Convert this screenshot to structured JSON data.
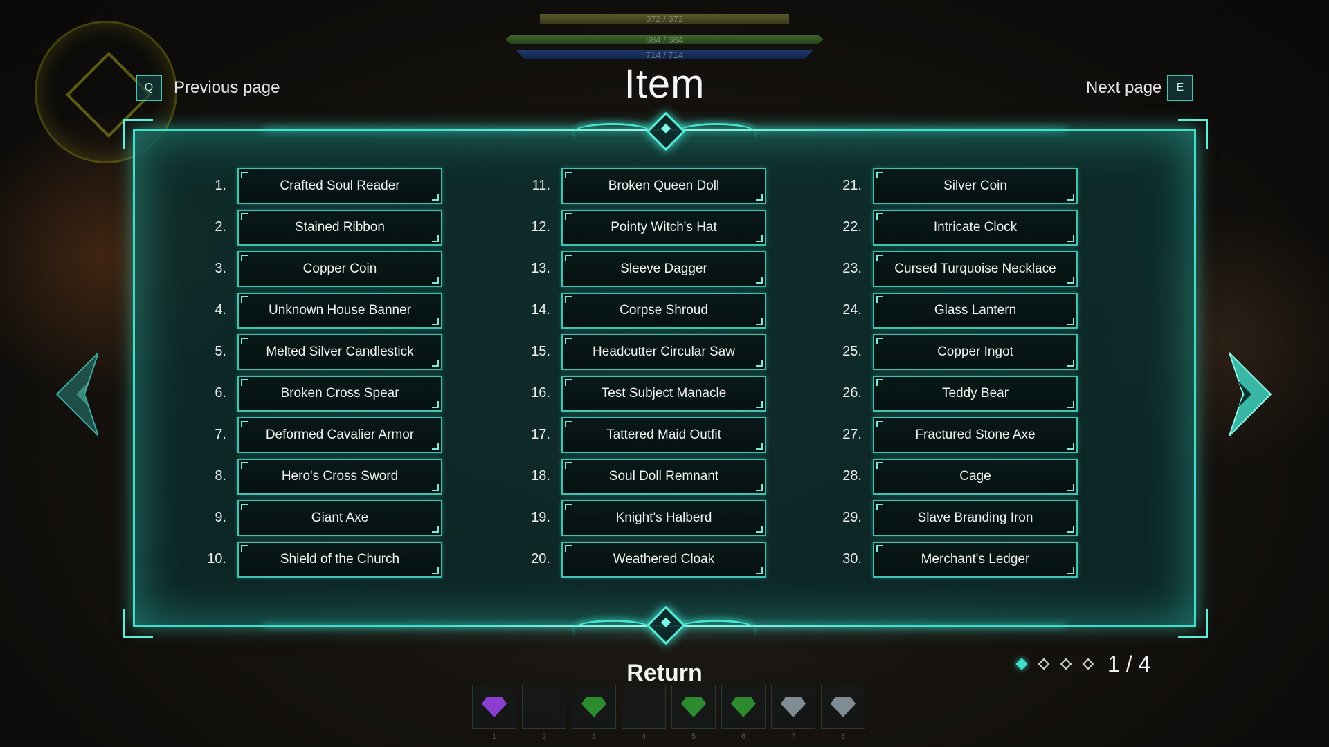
{
  "hud": {
    "hp_text": "372 / 372",
    "sp_text": "684 / 684",
    "mp_text": "714 / 714"
  },
  "header": {
    "title": "Item",
    "prev_key": "Q",
    "prev_label": "Previous page",
    "next_key": "E",
    "next_label": "Next page"
  },
  "items": [
    {
      "num": "1.",
      "name": "Crafted Soul Reader"
    },
    {
      "num": "2.",
      "name": "Stained Ribbon"
    },
    {
      "num": "3.",
      "name": "Copper Coin"
    },
    {
      "num": "4.",
      "name": "Unknown House Banner"
    },
    {
      "num": "5.",
      "name": "Melted Silver Candlestick"
    },
    {
      "num": "6.",
      "name": "Broken Cross Spear"
    },
    {
      "num": "7.",
      "name": "Deformed Cavalier Armor"
    },
    {
      "num": "8.",
      "name": "Hero's Cross Sword"
    },
    {
      "num": "9.",
      "name": "Giant Axe"
    },
    {
      "num": "10.",
      "name": "Shield of the Church"
    },
    {
      "num": "11.",
      "name": "Broken Queen Doll"
    },
    {
      "num": "12.",
      "name": "Pointy Witch's Hat"
    },
    {
      "num": "13.",
      "name": "Sleeve Dagger"
    },
    {
      "num": "14.",
      "name": "Corpse Shroud"
    },
    {
      "num": "15.",
      "name": "Headcutter Circular Saw"
    },
    {
      "num": "16.",
      "name": "Test Subject Manacle"
    },
    {
      "num": "17.",
      "name": "Tattered Maid Outfit"
    },
    {
      "num": "18.",
      "name": "Soul Doll Remnant"
    },
    {
      "num": "19.",
      "name": "Knight's Halberd"
    },
    {
      "num": "20.",
      "name": "Weathered Cloak"
    },
    {
      "num": "21.",
      "name": "Silver Coin"
    },
    {
      "num": "22.",
      "name": "Intricate Clock"
    },
    {
      "num": "23.",
      "name": "Cursed Turquoise Necklace"
    },
    {
      "num": "24.",
      "name": "Glass Lantern"
    },
    {
      "num": "25.",
      "name": "Copper Ingot"
    },
    {
      "num": "26.",
      "name": "Teddy Bear"
    },
    {
      "num": "27.",
      "name": "Fractured Stone Axe"
    },
    {
      "num": "28.",
      "name": "Cage"
    },
    {
      "num": "29.",
      "name": "Slave Branding Iron"
    },
    {
      "num": "30.",
      "name": "Merchant's Ledger"
    }
  ],
  "pager": {
    "current": 1,
    "total": 4,
    "text": "1 / 4"
  },
  "footer": {
    "return_label": "Return"
  },
  "hotbar": [
    {
      "num": "1",
      "gem": "purple-gem-icon",
      "color": "#8a3fd0"
    },
    {
      "num": "2",
      "gem": "",
      "color": ""
    },
    {
      "num": "3",
      "gem": "green-gem-icon",
      "color": "#2e8a2e"
    },
    {
      "num": "4",
      "gem": "",
      "color": ""
    },
    {
      "num": "5",
      "gem": "green-gem-icon",
      "color": "#2e8a2e"
    },
    {
      "num": "6",
      "gem": "green-gem-icon",
      "color": "#2e8a2e"
    },
    {
      "num": "7",
      "gem": "silver-gem-icon",
      "color": "#7f8c94"
    },
    {
      "num": "8",
      "gem": "silver-gem-icon",
      "color": "#7f8c94"
    }
  ],
  "colors": {
    "accent": "#40e0cc",
    "panel": "#0c3230"
  }
}
